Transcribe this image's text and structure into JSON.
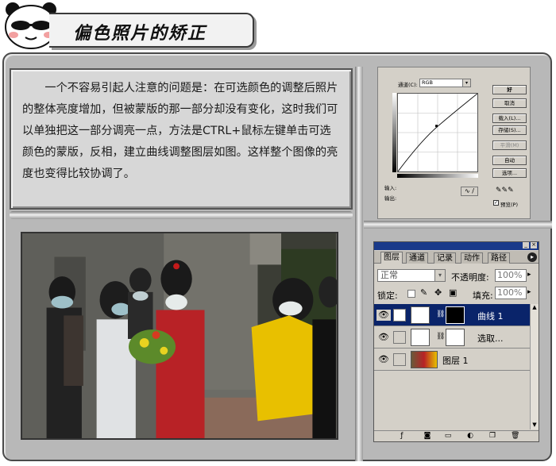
{
  "header": {
    "title": "偏色照片的矫正"
  },
  "article": {
    "text": "一个不容易引起人注意的问题是：在可选颜色的调整后照片的整体亮度增加，但被蒙版的那一部分却没有变化，这时我们可以单独把这一部分调亮一点，方法是CTRL+鼠标左键单击可选颜色的蒙版，反相，建立曲线调整图层如图。这样整个图像的亮度也变得比较协调了。"
  },
  "curves_dialog": {
    "channel_label": "通道(C):",
    "channel_value": "RGB",
    "buttons": {
      "ok": "好",
      "cancel": "取消",
      "load": "载入(L)...",
      "save": "存储(S)...",
      "smooth": "平滑(M)",
      "auto": "自动",
      "options": "选项..."
    },
    "input_label": "输入:",
    "output_label": "输出:",
    "preview_label": "预览(P)"
  },
  "layers_panel": {
    "tabs": [
      "图层",
      "通道",
      "记录",
      "动作",
      "路径"
    ],
    "blend_mode": "正常",
    "opacity_label": "不透明度:",
    "opacity_value": "100%",
    "lock_label": "锁定:",
    "fill_label": "填充:",
    "fill_value": "100%",
    "layers": [
      {
        "name": "曲线 1",
        "selected": true
      },
      {
        "name": "选取...",
        "selected": false
      },
      {
        "name": "图层 1",
        "selected": false
      }
    ]
  },
  "colors": {
    "frame": "#b8b8b8",
    "textbox": "#d7d7d7",
    "selection": "#0a246a",
    "title_bar": "#1a3a8a"
  }
}
